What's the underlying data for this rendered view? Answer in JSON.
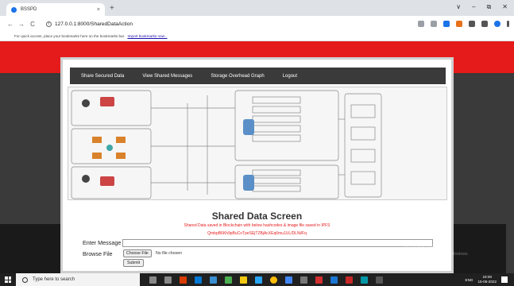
{
  "browser": {
    "tab_title": "BSSPD",
    "tab_close": "×",
    "new_tab": "+",
    "window_controls": [
      "∨",
      "–",
      "⧉",
      "✕"
    ],
    "back": "←",
    "forward": "→",
    "reload": "C",
    "url": "127.0.0.1:8000/SharedDataAction",
    "bookmarks_text": "For quick access, place your bookmarks here on the bookmarks bar.",
    "bookmarks_link": "Import bookmarks now..."
  },
  "nav": {
    "items": [
      "Share Secured Data",
      "View Shared Messages",
      "Storage Overhead Graph",
      "Logout"
    ]
  },
  "main": {
    "title": "Shared Data Screen",
    "status_line1": "Shared Data saved in Blockchain with below hashcodes & image file saved in IPFS",
    "status_line2": "QmbpB6Kh9pBuCoTpeSEjTZBjAcXEq6mu1UL/DLNi/Fq",
    "message_label": "Enter Message",
    "message_value": "",
    "file_label": "Browse File",
    "choose_file": "Choose File",
    "no_file": "No file chosen",
    "submit": "Submit"
  },
  "watermark": {
    "line1": "Activate Windows",
    "line2": "Go to Settings to activate Windows."
  },
  "taskbar": {
    "search_placeholder": "Type here to search",
    "time": "19:00",
    "date": "15-06-2022",
    "lang": "ENG"
  },
  "colors": {
    "header_red": "#e51a1a",
    "nav_dark": "#3a3a3a"
  }
}
